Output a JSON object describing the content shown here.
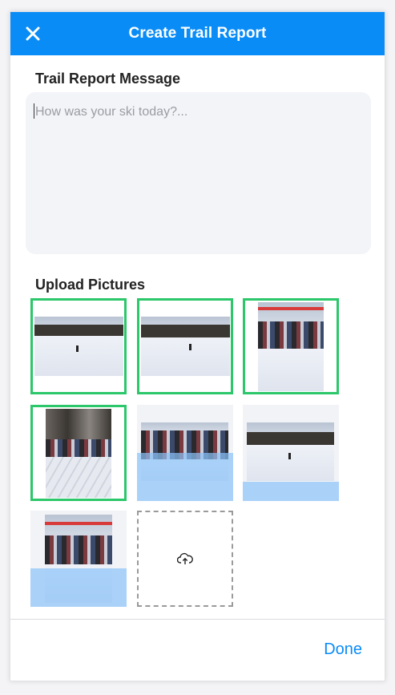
{
  "header": {
    "title": "Create Trail Report",
    "close_icon": "close-icon"
  },
  "message": {
    "label": "Trail Report Message",
    "placeholder": "How was your ski today?..."
  },
  "pictures": {
    "label": "Upload Pictures",
    "items": [
      {
        "selected": true,
        "uploading": false,
        "upload_progress": 1.0
      },
      {
        "selected": true,
        "uploading": false,
        "upload_progress": 1.0
      },
      {
        "selected": true,
        "uploading": false,
        "upload_progress": 1.0
      },
      {
        "selected": true,
        "uploading": false,
        "upload_progress": 1.0
      },
      {
        "selected": false,
        "uploading": true,
        "upload_progress": 0.5
      },
      {
        "selected": false,
        "uploading": true,
        "upload_progress": 0.8
      },
      {
        "selected": false,
        "uploading": true,
        "upload_progress": 0.4
      }
    ],
    "add_icon": "cloud-upload-icon"
  },
  "footer": {
    "done_label": "Done"
  },
  "colors": {
    "accent": "#0a8cf7",
    "selected_border": "#2bc76a",
    "upload_overlay": "#8cc3fa"
  }
}
